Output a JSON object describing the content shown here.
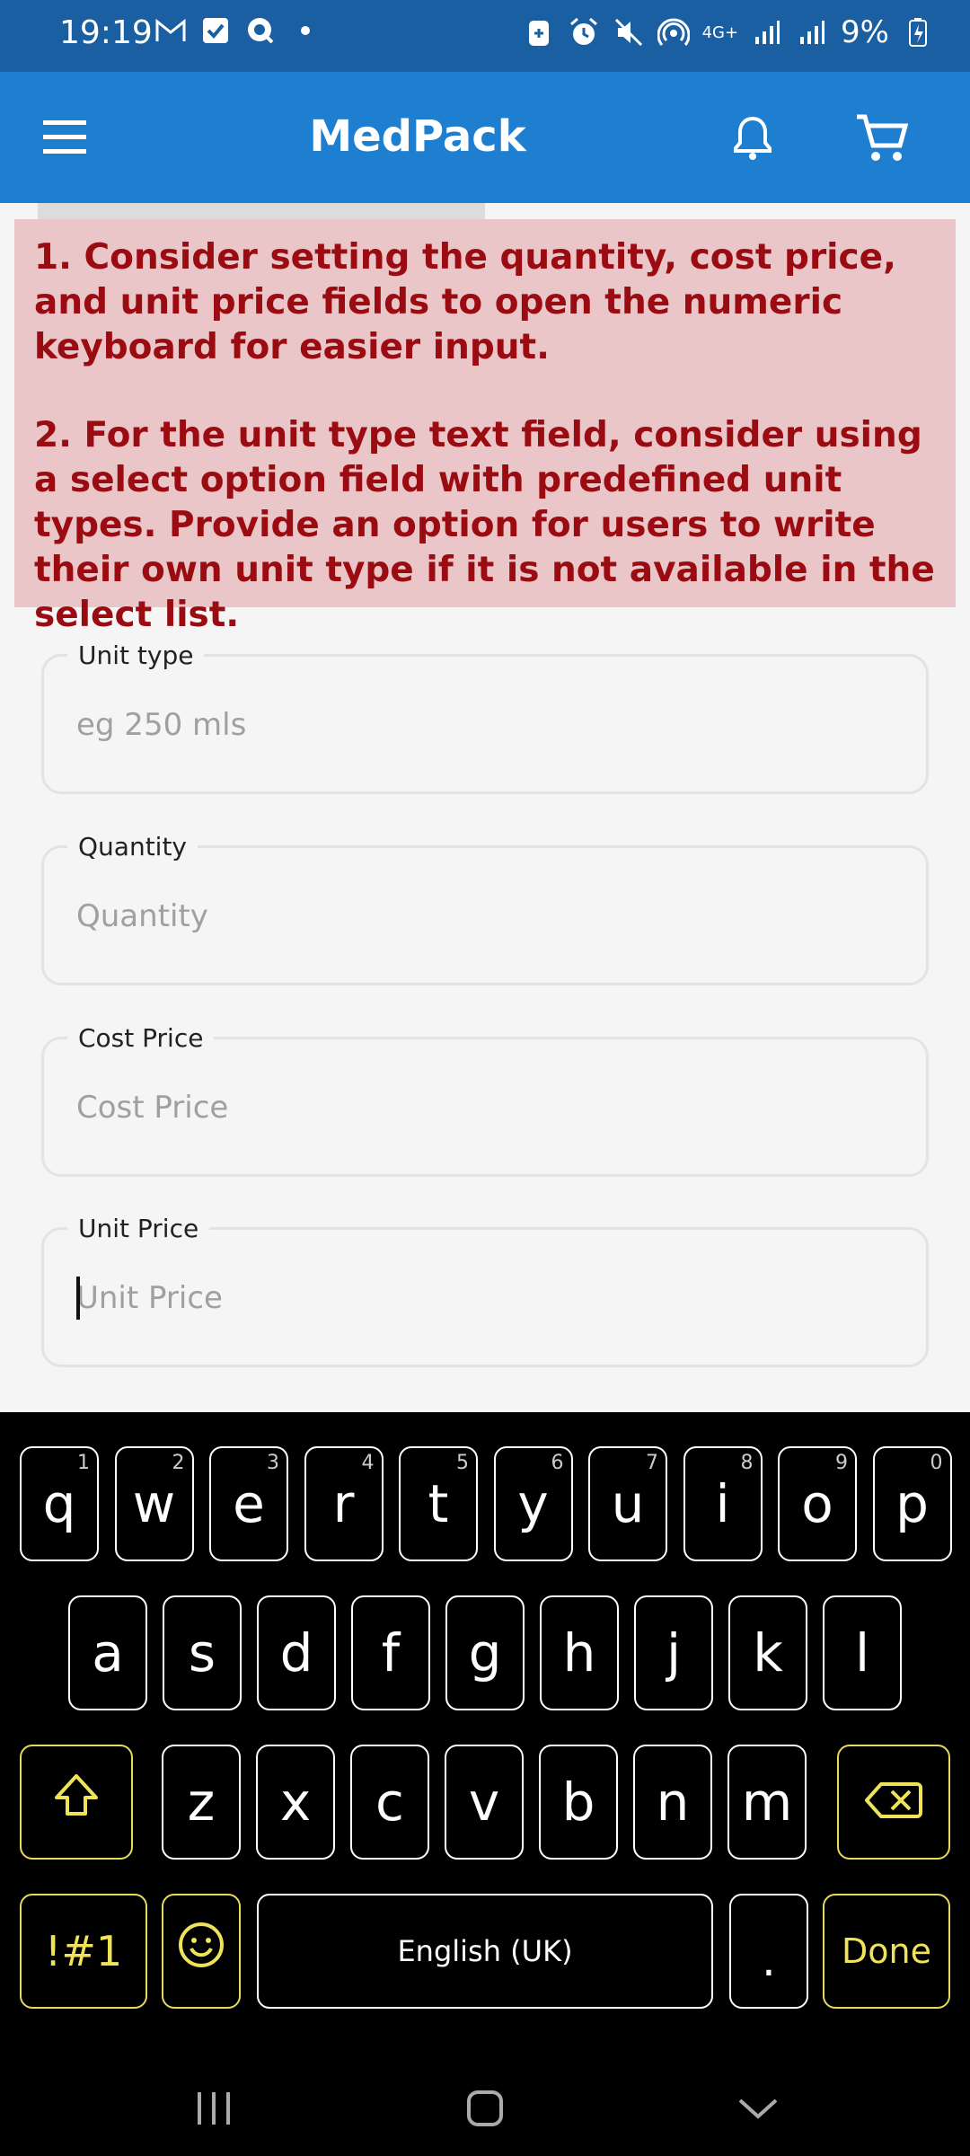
{
  "status": {
    "time": "19:19",
    "network": "4G+",
    "battery": "9%",
    "icons": [
      "gmail-icon",
      "check-icon",
      "q-app-icon",
      "dot-icon",
      "battery-saver-icon",
      "alarm-icon",
      "mute-icon",
      "hotspot-icon",
      "signal-icon",
      "signal2-icon",
      "battery-icon"
    ]
  },
  "app": {
    "title": "MedPack",
    "icons": [
      "menu-icon",
      "bell-icon",
      "cart-icon"
    ],
    "accent": "#1e7fd0"
  },
  "notice": {
    "item1": "1. Consider setting the quantity, cost price, and unit price fields to open the numeric keyboard for easier input.",
    "item2": "2. For the unit type text field, consider using a select option field with predefined unit types. Provide an option for users to write their own unit type if it is not available in the select list.",
    "bg": "#ebc6c8",
    "color": "#9a0b12"
  },
  "form": {
    "unit_type": {
      "label": "Unit type",
      "placeholder": "eg 250 mls",
      "value": ""
    },
    "quantity": {
      "label": "Quantity",
      "placeholder": "Quantity",
      "value": ""
    },
    "cost_price": {
      "label": "Cost Price",
      "placeholder": "Cost Price",
      "value": ""
    },
    "unit_price": {
      "label": "Unit Price",
      "placeholder": "Unit Price",
      "value": ""
    }
  },
  "keyboard": {
    "row1": [
      {
        "k": "q",
        "n": "1"
      },
      {
        "k": "w",
        "n": "2"
      },
      {
        "k": "e",
        "n": "3"
      },
      {
        "k": "r",
        "n": "4"
      },
      {
        "k": "t",
        "n": "5"
      },
      {
        "k": "y",
        "n": "6"
      },
      {
        "k": "u",
        "n": "7"
      },
      {
        "k": "i",
        "n": "8"
      },
      {
        "k": "o",
        "n": "9"
      },
      {
        "k": "p",
        "n": "0"
      }
    ],
    "row2": [
      "a",
      "s",
      "d",
      "f",
      "g",
      "h",
      "j",
      "k",
      "l"
    ],
    "row3": [
      "z",
      "x",
      "c",
      "v",
      "b",
      "n",
      "m"
    ],
    "symbols": "!#1",
    "space": "English (UK)",
    "period": ".",
    "done": "Done",
    "icons": [
      "shift-icon",
      "backspace-icon",
      "emoji-icon"
    ]
  },
  "navbar": {
    "icons": [
      "recents-icon",
      "home-icon",
      "hide-keyboard-icon"
    ]
  }
}
